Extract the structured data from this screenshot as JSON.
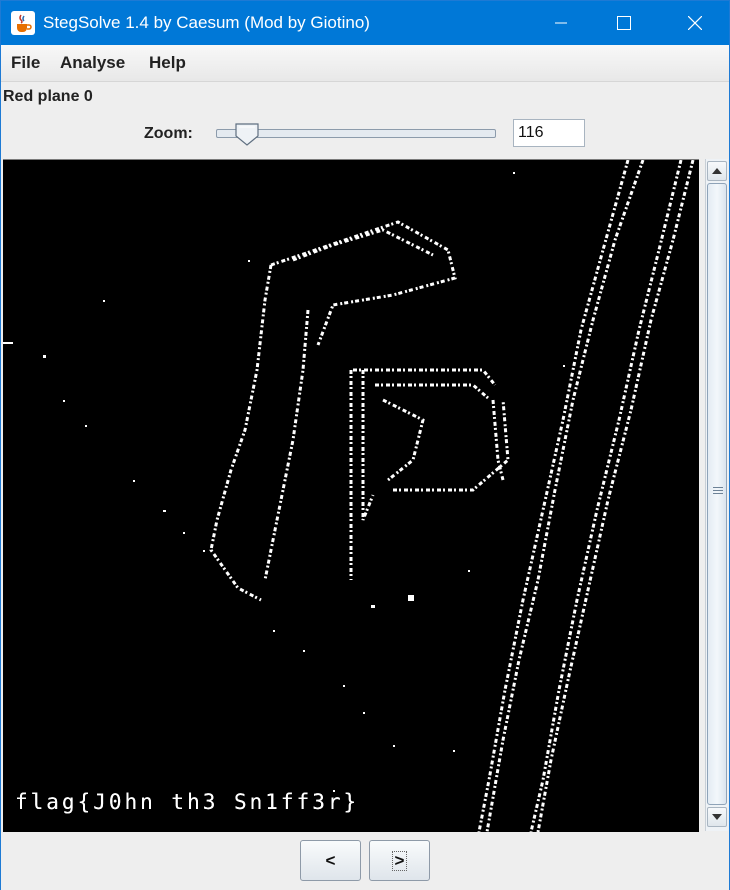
{
  "window": {
    "title": "StegSolve 1.4 by Caesum (Mod by Giotino)",
    "icon": "java-cup-icon"
  },
  "menu": [
    "File",
    "Analyse",
    "Help"
  ],
  "plane_label": "Red plane 0",
  "zoom": {
    "label": "Zoom:",
    "value": "116",
    "level": 0.1
  },
  "image": {
    "embedded_text": "flag{J0hn th3 Sn1ff3r}",
    "background": "#000000",
    "foreground": "#ffffff"
  },
  "nav": {
    "prev": "<",
    "next": ">"
  },
  "colors": {
    "titlebar": "#0078d7",
    "window_bg": "#eeeeee"
  }
}
